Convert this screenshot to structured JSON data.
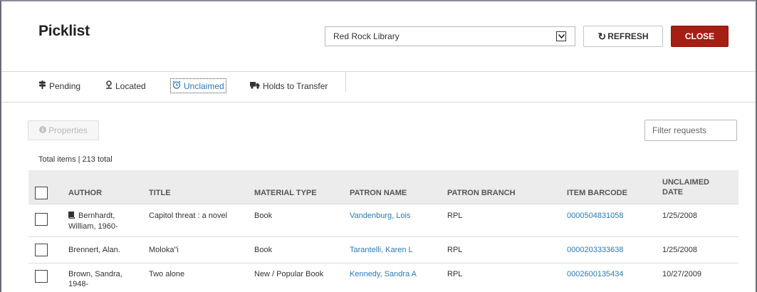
{
  "header": {
    "title": "Picklist",
    "library": "Red Rock Library",
    "refresh_label": "REFRESH",
    "close_label": "CLOSE"
  },
  "tabs": [
    {
      "label": "Pending",
      "icon": "signpost-icon",
      "active": false
    },
    {
      "label": "Located",
      "icon": "location-pin-icon",
      "active": false
    },
    {
      "label": "Unclaimed",
      "icon": "alarm-clock-icon",
      "active": true
    },
    {
      "label": "Holds to Transfer",
      "icon": "truck-icon",
      "active": false
    }
  ],
  "toolbar": {
    "properties_label": "Properties",
    "filter_placeholder": "Filter requests"
  },
  "summary": {
    "total_text": "Total items | 213 total"
  },
  "table": {
    "columns": [
      "AUTHOR",
      "TITLE",
      "MATERIAL TYPE",
      "PATRON NAME",
      "PATRON BRANCH",
      "ITEM BARCODE",
      "UNCLAIMED DATE"
    ],
    "rows": [
      {
        "author": "Bernhardt, William, 1960-",
        "author_icon": "book-icon",
        "title": "Capitol threat : a novel",
        "material": "Book",
        "patron": "Vandenburg, Lois",
        "branch": "RPL",
        "barcode": "0000504831058",
        "date": "1/25/2008"
      },
      {
        "author": "Brennert, Alan.",
        "title": "Moloka\"i",
        "material": "Book",
        "patron": "Tarantelli, Karen L",
        "branch": "RPL",
        "barcode": "0000203333638",
        "date": "1/25/2008"
      },
      {
        "author": "Brown, Sandra, 1948-",
        "title": "Two alone",
        "material": "New / Popular Book",
        "patron": "Kennedy, Sandra A",
        "branch": "RPL",
        "barcode": "0002600135434",
        "date": "10/27/2009"
      }
    ]
  },
  "colors": {
    "accent_link": "#2a7ab8",
    "close_button": "#a61e14",
    "header_row_bg": "#ececec"
  }
}
